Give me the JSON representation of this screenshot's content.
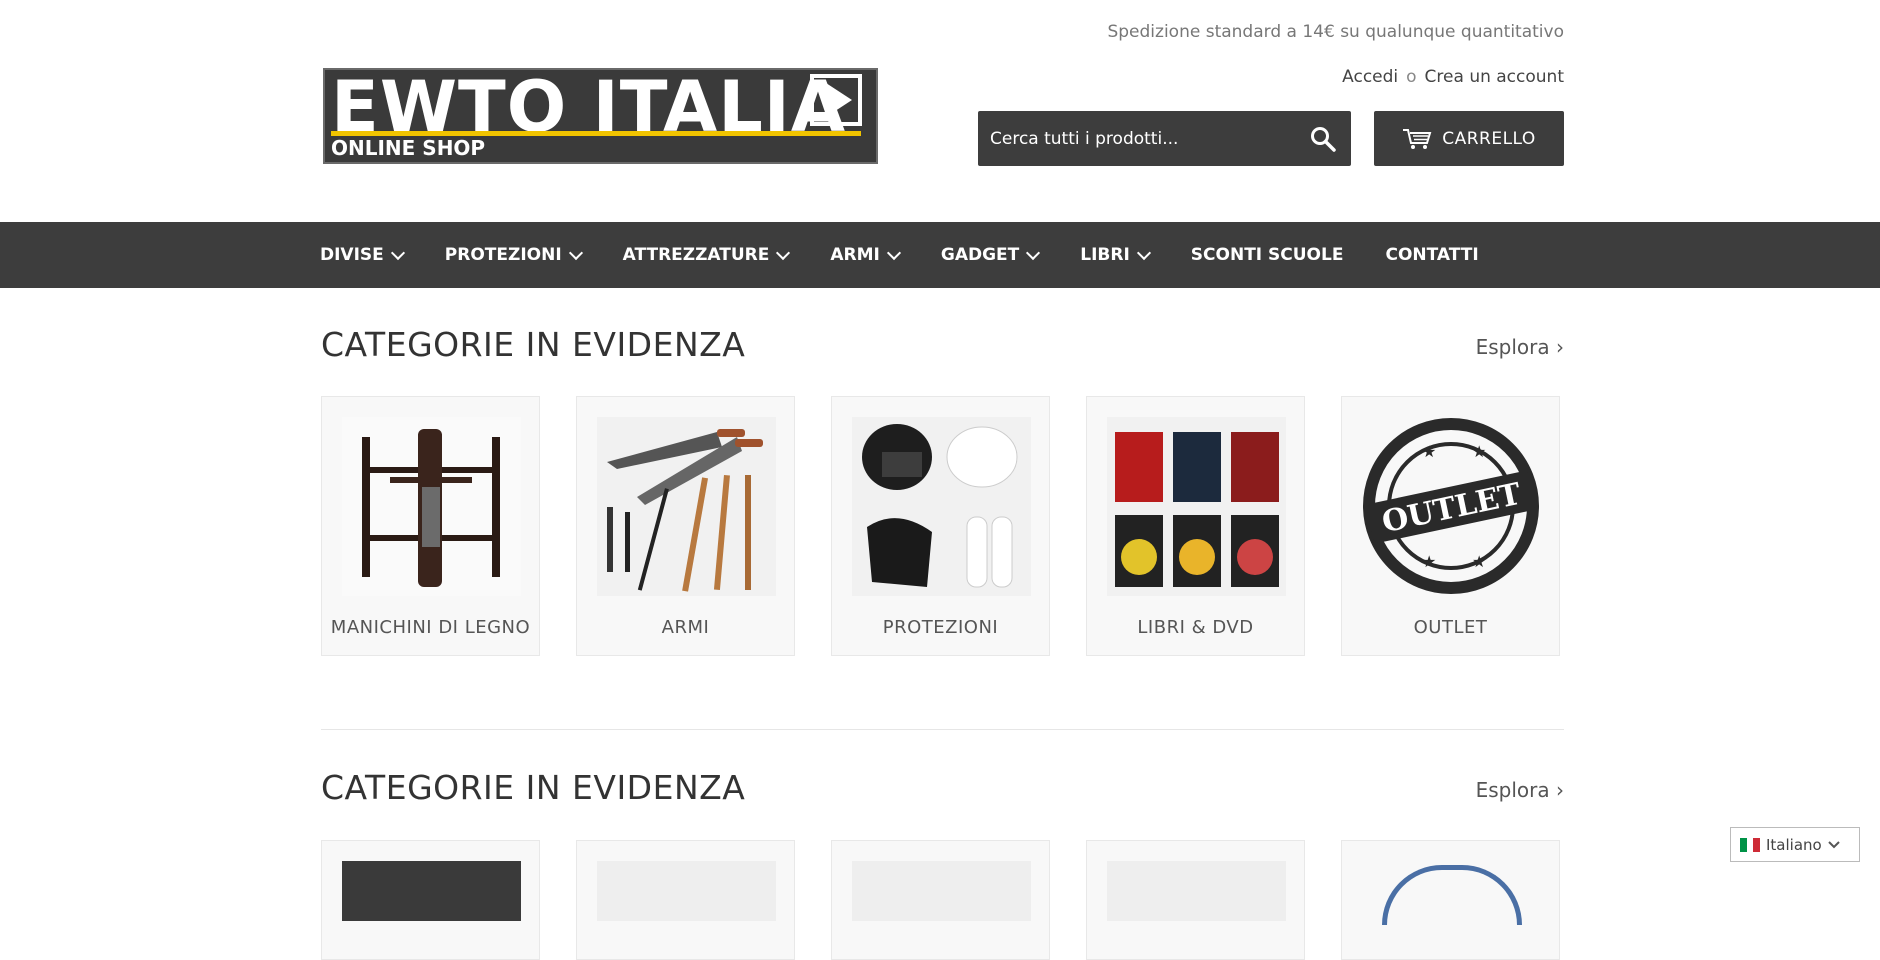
{
  "header": {
    "shipping_notice": "Spedizione standard a 14€ su qualunque quantitativo",
    "login_label": "Accedi",
    "or_label": "o",
    "register_label": "Crea un account",
    "search_placeholder": "Cerca tutti i prodotti...",
    "cart_label": "CARRELLO"
  },
  "logo": {
    "title": "EWTO  ITALIA",
    "subtitle": "ONLINE SHOP",
    "accent_color": "#f1c400"
  },
  "nav": {
    "items": [
      {
        "label": "DIVISE",
        "has_dropdown": true
      },
      {
        "label": "PROTEZIONI",
        "has_dropdown": true
      },
      {
        "label": "ATTREZZATURE",
        "has_dropdown": true
      },
      {
        "label": "ARMI",
        "has_dropdown": true
      },
      {
        "label": "GADGET",
        "has_dropdown": true
      },
      {
        "label": "LIBRI",
        "has_dropdown": true
      },
      {
        "label": "SCONTI SCUOLE",
        "has_dropdown": false
      },
      {
        "label": "CONTATTI",
        "has_dropdown": false
      }
    ]
  },
  "sections": [
    {
      "title": "CATEGORIE IN EVIDENZA",
      "explore_label": "Esplora ›",
      "categories": [
        {
          "label": "MANICHINI DI LEGNO",
          "icon": "wooden-dummy"
        },
        {
          "label": "ARMI",
          "icon": "weapons"
        },
        {
          "label": "PROTEZIONI",
          "icon": "protections"
        },
        {
          "label": "LIBRI & DVD",
          "icon": "books"
        },
        {
          "label": "OUTLET",
          "icon": "outlet-stamp"
        }
      ]
    },
    {
      "title": "CATEGORIE IN EVIDENZA",
      "explore_label": "Esplora ›"
    }
  ],
  "language": {
    "selected": "Italiano"
  },
  "colors": {
    "dark_bar": "#3d3d3d",
    "card_bg": "#f8f8f8"
  }
}
